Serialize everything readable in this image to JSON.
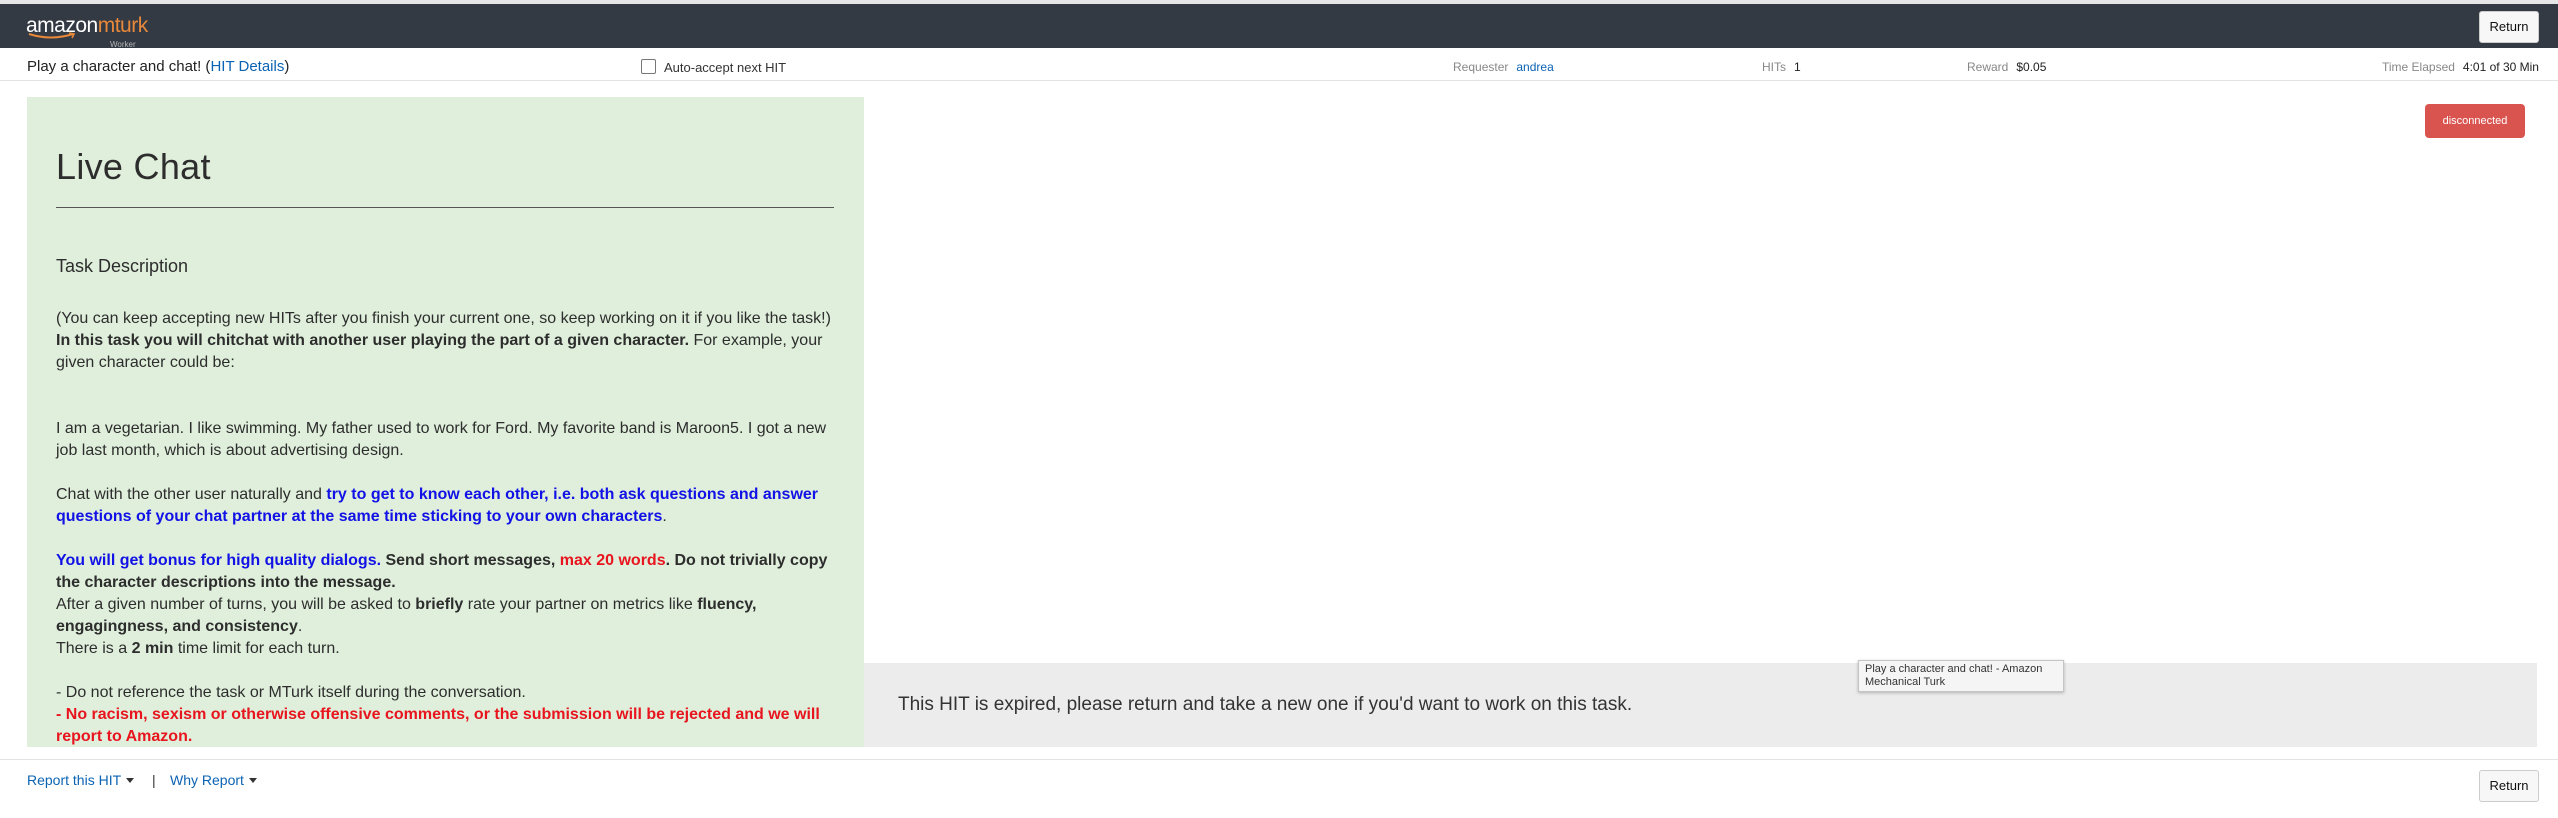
{
  "navbar": {
    "logo_brand": "amazon",
    "logo_product": "mturk",
    "logo_sub": "Worker",
    "return_label": "Return"
  },
  "hit_info": {
    "title_prefix": "Play a character and chat! (",
    "details_link": "HIT Details",
    "title_suffix": ")",
    "auto_accept_label": "Auto-accept next HIT",
    "auto_accept_checked": false,
    "requester_label": "Requester",
    "requester_value": "andrea",
    "hits_label": "HITs",
    "hits_value": "1",
    "reward_label": "Reward",
    "reward_value": "$0.05",
    "time_label": "Time Elapsed",
    "time_value": "4:01 of 30 Min"
  },
  "task_panel": {
    "title": "Live Chat",
    "heading": "Task Description",
    "p1": "(You can keep accepting new HITs after you finish your current one, so keep working on it if you like the task!)",
    "p2_bold": "In this task you will chitchat with another user playing the part of a given character.",
    "p2_rest": " For example, your given character could be:",
    "p3": "I am a vegetarian. I like swimming. My father used to work for Ford. My favorite band is Maroon5. I got a new job last month, which is about advertising design.",
    "p4_start": "Chat with the other user naturally and ",
    "p4_blue": "try to get to know each other, i.e. both ask questions and answer questions of your chat partner at the same time sticking to your own characters",
    "p4_end": ".",
    "p5_blue": "You will get bonus for high quality dialogs.",
    "p5_bold1": " Send short messages, ",
    "p5_red": "max 20 words",
    "p5_bold2": ". Do not trivially copy the character descriptions into the message.",
    "p6_start": "After a given number of turns, you will be asked to ",
    "p6_b1": "briefly",
    "p6_mid": " rate your partner on metrics like ",
    "p6_b2": "fluency, engagingness, and consistency",
    "p6_end": ".",
    "p7_start": "There is a ",
    "p7_bold": "2 min",
    "p7_end": " time limit for each turn.",
    "p8": "- Do not reference the task or MTurk itself during the conversation.",
    "p9_red": "- No racism, sexism or otherwise offensive comments, or the submission will be rejected and we will report to Amazon."
  },
  "status": {
    "connection_label": "disconnected",
    "connection_color": "#d9534f"
  },
  "expired": {
    "message": "This HIT is expired, please return and take a new one if you'd want to work on this task."
  },
  "tooltip": {
    "text": "Play a character and chat! - Amazon Mechanical Turk"
  },
  "footer": {
    "report_label": "Report this HIT",
    "separator": "|",
    "why_label": "Why Report",
    "return_label": "Return"
  },
  "colors": {
    "navbar_bg": "#343a44",
    "panel_bg": "#dfefdb",
    "link_blue": "#0b63b3",
    "emphasis_blue": "#1212e6",
    "emphasis_red": "#e8151f"
  }
}
